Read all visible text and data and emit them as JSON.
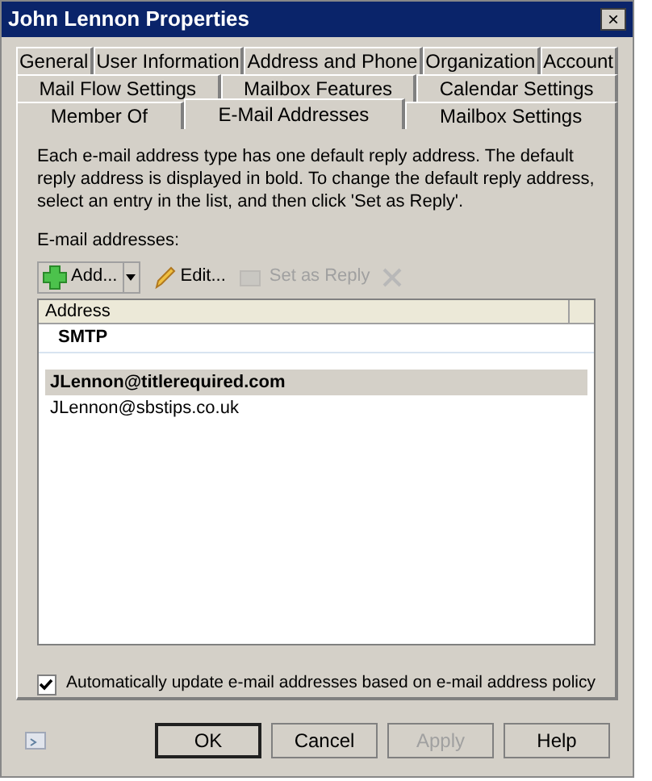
{
  "window": {
    "title": "John Lennon Properties",
    "close_label": "×"
  },
  "tab_rows": [
    [
      {
        "label": "General",
        "selected": false
      },
      {
        "label": "User Information",
        "selected": false
      },
      {
        "label": "Address and Phone",
        "selected": false
      },
      {
        "label": "Organization",
        "selected": false
      },
      {
        "label": "Account",
        "selected": false
      }
    ],
    [
      {
        "label": "Mail Flow Settings",
        "selected": false
      },
      {
        "label": "Mailbox Features",
        "selected": false
      },
      {
        "label": "Calendar Settings",
        "selected": false
      }
    ],
    [
      {
        "label": "Member Of",
        "selected": false
      },
      {
        "label": "E-Mail Addresses",
        "selected": true
      },
      {
        "label": "Mailbox Settings",
        "selected": false
      }
    ]
  ],
  "description": "Each e-mail address type has one default reply address. The default reply address is displayed in bold. To change the default reply address, select an entry in the list, and then click 'Set as Reply'.",
  "list_label": "E-mail addresses:",
  "toolbar": [
    {
      "kind": "add",
      "label": "Add...",
      "disabled": false
    },
    {
      "kind": "edit",
      "label": "Edit...",
      "disabled": false
    },
    {
      "kind": "reply",
      "label": "Set as Reply",
      "disabled": true
    },
    {
      "kind": "remove",
      "disabled": true
    }
  ],
  "table": {
    "columns": [
      "Address"
    ],
    "groups": [
      {
        "name": "SMTP",
        "rows": [
          {
            "address": "JLennon@titlerequired.com",
            "default": true,
            "selected": true
          },
          {
            "address": "JLennon@sbstips.co.uk",
            "default": false,
            "selected": false
          }
        ]
      }
    ]
  },
  "auto_update": {
    "label": "Automatically update e-mail addresses based on e-mail address policy",
    "checked": true
  },
  "buttons": [
    {
      "label": "OK",
      "default": true,
      "disabled": false
    },
    {
      "label": "Cancel",
      "default": false,
      "disabled": false
    },
    {
      "label": "Apply",
      "default": false,
      "disabled": true
    },
    {
      "label": "Help",
      "default": false,
      "disabled": false
    }
  ]
}
